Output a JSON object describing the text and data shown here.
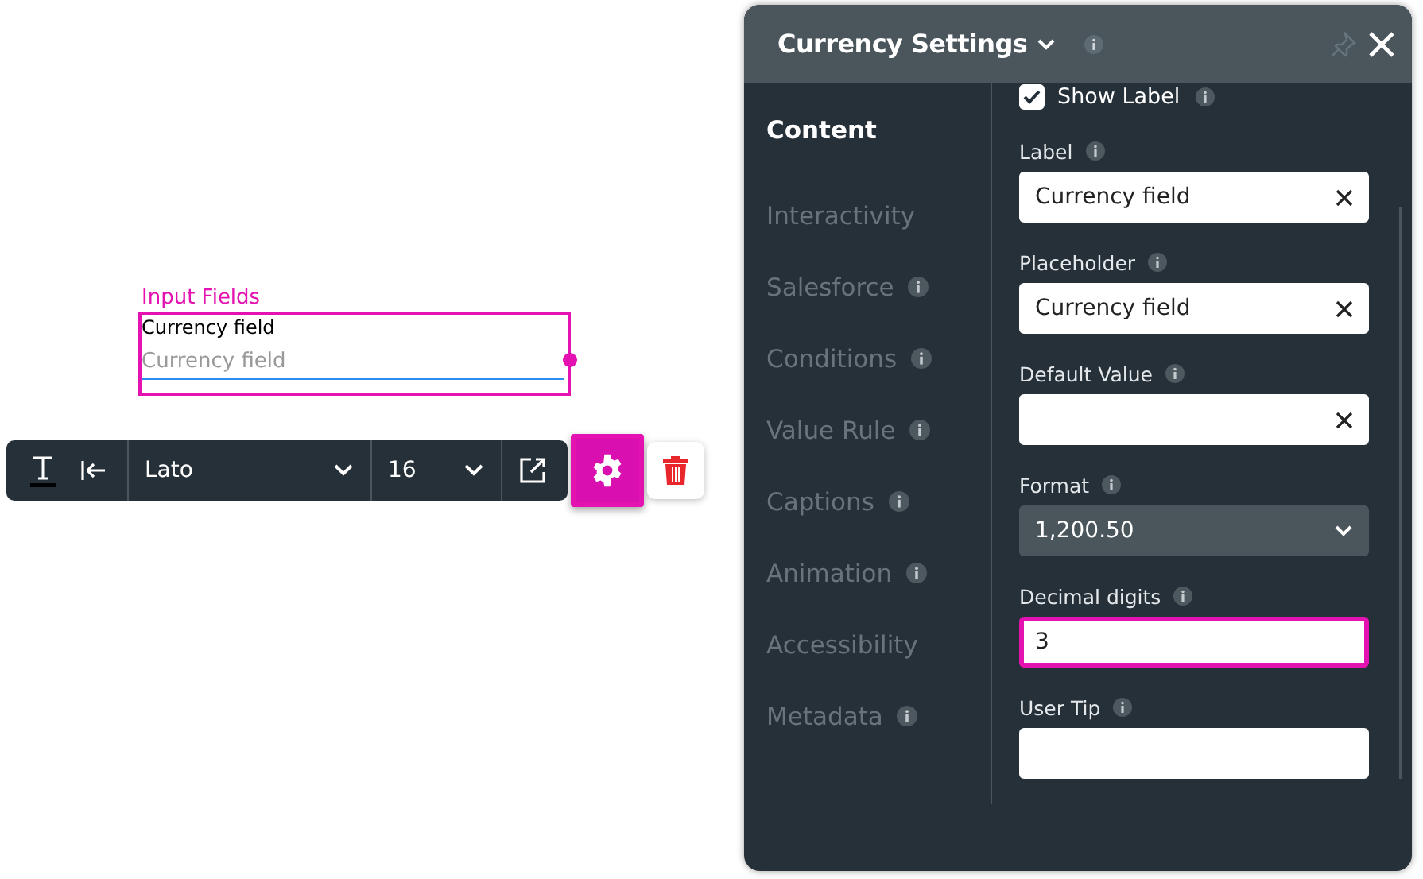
{
  "canvas": {
    "component_title": "Input Fields",
    "field_label": "Currency field",
    "field_placeholder": "Currency field"
  },
  "toolbar": {
    "font": "Lato",
    "size": "16",
    "settings_selected": true
  },
  "panel": {
    "title": "Currency Settings",
    "nav": [
      {
        "label": "Content",
        "selected": true,
        "info": false
      },
      {
        "label": "Interactivity",
        "selected": false,
        "info": false
      },
      {
        "label": "Salesforce",
        "selected": false,
        "info": true
      },
      {
        "label": "Conditions",
        "selected": false,
        "info": true
      },
      {
        "label": "Value Rule",
        "selected": false,
        "info": true
      },
      {
        "label": "Captions",
        "selected": false,
        "info": true
      },
      {
        "label": "Animation",
        "selected": false,
        "info": true
      },
      {
        "label": "Accessibility",
        "selected": false,
        "info": false
      },
      {
        "label": "Metadata",
        "selected": false,
        "info": true
      }
    ],
    "show_label": {
      "label": "Show Label",
      "checked": true
    },
    "fields": [
      {
        "kind": "input",
        "label": "Label",
        "value": "Currency field",
        "clearable": true,
        "highlighted": false
      },
      {
        "kind": "input",
        "label": "Placeholder",
        "value": "Currency field",
        "clearable": true,
        "highlighted": false
      },
      {
        "kind": "input",
        "label": "Default Value",
        "clearable": true,
        "highlighted": false
      },
      {
        "kind": "select",
        "label": "Format",
        "value": "1,200.50",
        "clearable": false,
        "highlighted": false
      },
      {
        "kind": "input",
        "label": "Decimal digits",
        "value": "3",
        "clearable": false,
        "highlighted": true
      },
      {
        "kind": "input",
        "label": "User Tip",
        "clearable": false,
        "highlighted": false
      }
    ]
  }
}
